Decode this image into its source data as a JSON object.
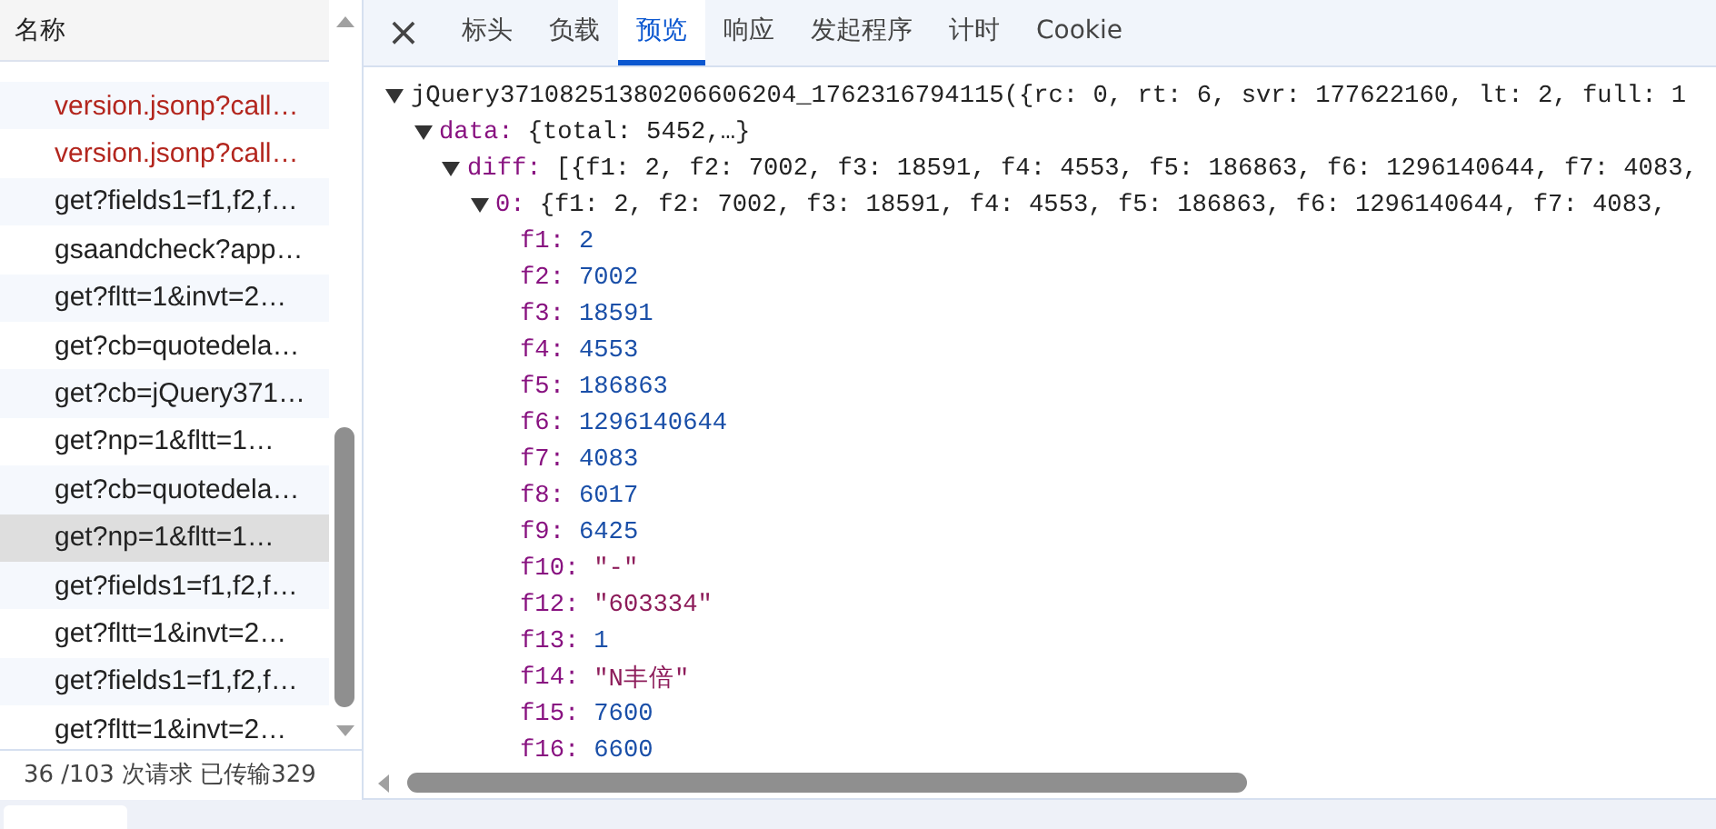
{
  "requests": {
    "column_header": "名称",
    "items": [
      {
        "name": "version.jsonp?call…",
        "failed": true,
        "selected": false
      },
      {
        "name": "version.jsonp?call…",
        "failed": true,
        "selected": false
      },
      {
        "name": "get?fields1=f1,f2,f…",
        "failed": false,
        "selected": false
      },
      {
        "name": "gsaandcheck?app…",
        "failed": false,
        "selected": false
      },
      {
        "name": "get?fltt=1&invt=2…",
        "failed": false,
        "selected": false
      },
      {
        "name": "get?cb=quotedela…",
        "failed": false,
        "selected": false
      },
      {
        "name": "get?cb=jQuery371…",
        "failed": false,
        "selected": false
      },
      {
        "name": "get?np=1&fltt=1…",
        "failed": false,
        "selected": false
      },
      {
        "name": "get?cb=quotedela…",
        "failed": false,
        "selected": false
      },
      {
        "name": "get?np=1&fltt=1…",
        "failed": false,
        "selected": true
      },
      {
        "name": "get?fields1=f1,f2,f…",
        "failed": false,
        "selected": false
      },
      {
        "name": "get?fltt=1&invt=2…",
        "failed": false,
        "selected": false
      },
      {
        "name": "get?fields1=f1,f2,f…",
        "failed": false,
        "selected": false
      },
      {
        "name": "get?fltt=1&invt=2…",
        "failed": false,
        "selected": false
      }
    ],
    "status": "36 /103 次请求   已传输329"
  },
  "close_button": "×",
  "tabs": [
    {
      "label": "标头",
      "selected": false
    },
    {
      "label": "负载",
      "selected": false
    },
    {
      "label": "预览",
      "selected": true
    },
    {
      "label": "响应",
      "selected": false
    },
    {
      "label": "发起程序",
      "selected": false
    },
    {
      "label": "计时",
      "selected": false
    },
    {
      "label": "Cookie",
      "selected": false
    }
  ],
  "preview": {
    "text": "jQuery37108251380206606204_1762316794115({rc: 0, rt: 6, svr: 177622160, lt: 2, full: 1",
    "expanded": true,
    "children": [
      {
        "key": "data:",
        "summary": "{total: 5452,…}",
        "expanded": true,
        "children": [
          {
            "key": "diff:",
            "summary": "[{f1: 2, f2: 7002, f3: 18591, f4: 4553, f5: 186863, f6: 1296140644, f7: 4083,",
            "expanded": true,
            "children": [
              {
                "key": "0:",
                "summary": "{f1: 2, f2: 7002, f3: 18591, f4: 4553, f5: 186863, f6: 1296140644, f7: 4083,",
                "expanded": true,
                "children": [
                  {
                    "key": "f1:",
                    "value": "2",
                    "kind": "number"
                  },
                  {
                    "key": "f2:",
                    "value": "7002",
                    "kind": "number"
                  },
                  {
                    "key": "f3:",
                    "value": "18591",
                    "kind": "number"
                  },
                  {
                    "key": "f4:",
                    "value": "4553",
                    "kind": "number"
                  },
                  {
                    "key": "f5:",
                    "value": "186863",
                    "kind": "number"
                  },
                  {
                    "key": "f6:",
                    "value": "1296140644",
                    "kind": "number"
                  },
                  {
                    "key": "f7:",
                    "value": "4083",
                    "kind": "number"
                  },
                  {
                    "key": "f8:",
                    "value": "6017",
                    "kind": "number"
                  },
                  {
                    "key": "f9:",
                    "value": "6425",
                    "kind": "number"
                  },
                  {
                    "key": "f10:",
                    "value": "\"-\"",
                    "kind": "string"
                  },
                  {
                    "key": "f12:",
                    "value": "\"603334\"",
                    "kind": "string"
                  },
                  {
                    "key": "f13:",
                    "value": "1",
                    "kind": "number"
                  },
                  {
                    "key": "f14:",
                    "value": "\"N丰倍\"",
                    "kind": "string"
                  },
                  {
                    "key": "f15:",
                    "value": "7600",
                    "kind": "number"
                  },
                  {
                    "key": "f16:",
                    "value": "6600",
                    "kind": "number"
                  }
                ]
              }
            ]
          }
        ]
      }
    ]
  }
}
